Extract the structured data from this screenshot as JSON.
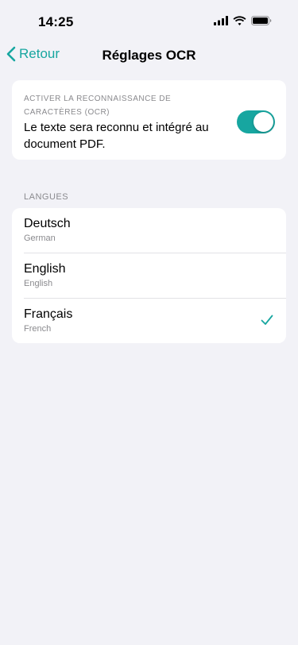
{
  "status_bar": {
    "time": "14:25"
  },
  "nav": {
    "back_label": "Retour",
    "title": "Réglages OCR"
  },
  "ocr": {
    "label": "ACTIVER LA RECONNAISSANCE DE CARACTÈRES (OCR)",
    "description": "Le texte sera reconnu et intégré au document PDF.",
    "enabled": true
  },
  "languages": {
    "header": "LANGUES",
    "items": [
      {
        "name": "Deutsch",
        "subtitle": "German",
        "selected": false
      },
      {
        "name": "English",
        "subtitle": "English",
        "selected": false
      },
      {
        "name": "Français",
        "subtitle": "French",
        "selected": true
      }
    ]
  },
  "colors": {
    "accent": "#17a6a0",
    "background": "#f2f2f7",
    "secondary_text": "#8a8a8e"
  }
}
